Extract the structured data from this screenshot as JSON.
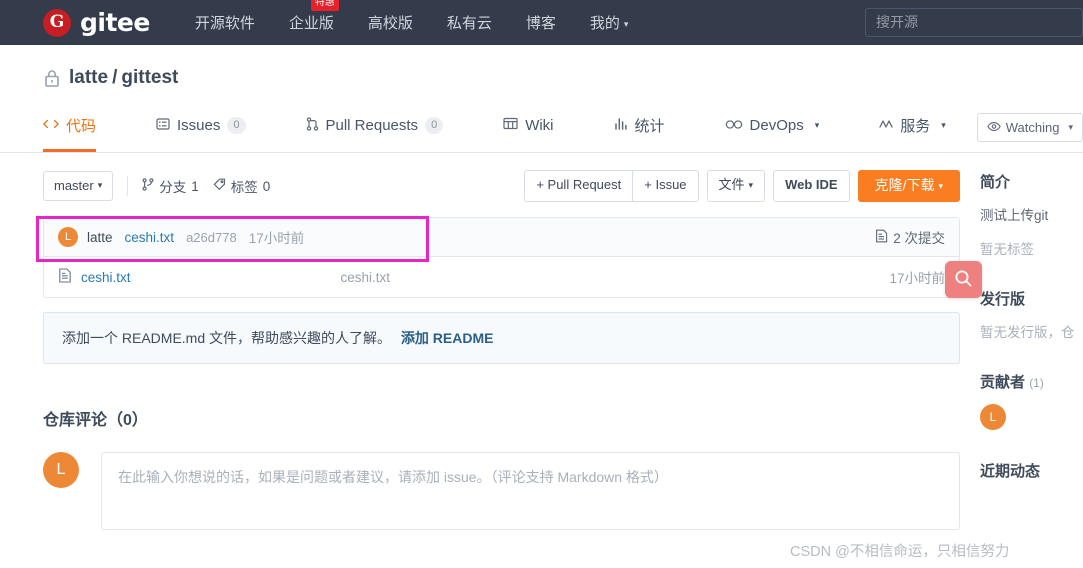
{
  "header": {
    "logo_letter": "G",
    "logo_text": "gitee",
    "nav": [
      {
        "label": "开源软件",
        "badge": null,
        "caret": false
      },
      {
        "label": "企业版",
        "badge": "特惠",
        "caret": false
      },
      {
        "label": "高校版",
        "badge": null,
        "caret": false
      },
      {
        "label": "私有云",
        "badge": null,
        "caret": false
      },
      {
        "label": "博客",
        "badge": null,
        "caret": false
      },
      {
        "label": "我的",
        "badge": null,
        "caret": true
      }
    ],
    "search_placeholder": "搜开源"
  },
  "repo": {
    "owner": "latte",
    "separator": "/",
    "name": "gittest",
    "visibility_icon": "lock-icon",
    "watching_label": "Watching",
    "watching_icon": "eye-icon"
  },
  "tabs": [
    {
      "label": "代码",
      "icon": "code-icon",
      "count": null,
      "active": true,
      "caret": false
    },
    {
      "label": "Issues",
      "icon": "issue-icon",
      "count": "0",
      "active": false,
      "caret": false
    },
    {
      "label": "Pull Requests",
      "icon": "pull-request-icon",
      "count": "0",
      "active": false,
      "caret": false
    },
    {
      "label": "Wiki",
      "icon": "wiki-icon",
      "count": null,
      "active": false,
      "caret": false
    },
    {
      "label": "统计",
      "icon": "chart-icon",
      "count": null,
      "active": false,
      "caret": false
    },
    {
      "label": "DevOps",
      "icon": "infinity-icon",
      "count": null,
      "active": false,
      "caret": true
    },
    {
      "label": "服务",
      "icon": "service-icon",
      "count": null,
      "active": false,
      "caret": true
    }
  ],
  "toolbar": {
    "branch": "master",
    "branches_label": "分支",
    "branches_count": "1",
    "tags_label": "标签",
    "tags_count": "0",
    "pull_request_btn": "+ Pull Request",
    "issue_btn": "+ Issue",
    "files_btn": "文件",
    "web_ide_btn": "Web IDE",
    "clone_btn": "克隆/下载"
  },
  "commit": {
    "avatar_letter": "L",
    "author": "latte",
    "message": "ceshi.txt",
    "sha": "a26d778",
    "time": "17小时前",
    "commits_count_label": "2 次提交",
    "commits_icon": "commit-history-icon"
  },
  "files": [
    {
      "icon": "file-text-icon",
      "name": "ceshi.txt",
      "message": "ceshi.txt",
      "time": "17小时前"
    }
  ],
  "float_search": {
    "icon": "search-icon",
    "color": "#ef8080"
  },
  "highlight": {
    "color": "#e824c6"
  },
  "readme_prompt": {
    "text": "添加一个 README.md 文件，帮助感兴趣的人了解。",
    "link": "添加 README"
  },
  "comments": {
    "title": "仓库评论（0）",
    "avatar_letter": "L",
    "placeholder": "在此输入你想说的话，如果是问题或者建议，请添加 issue。（评论支持 Markdown 格式）"
  },
  "sidebar": {
    "intro_title": "简介",
    "intro_desc": "测试上传git",
    "no_tags": "暂无标签",
    "release_title": "发行版",
    "release_empty": "暂无发行版，仓",
    "contributors_title": "贡献者",
    "contributors_count": "(1)",
    "contributor_letter": "L",
    "activity_title": "近期动态"
  },
  "watermark": "CSDN @不相信命运，只相信努力"
}
